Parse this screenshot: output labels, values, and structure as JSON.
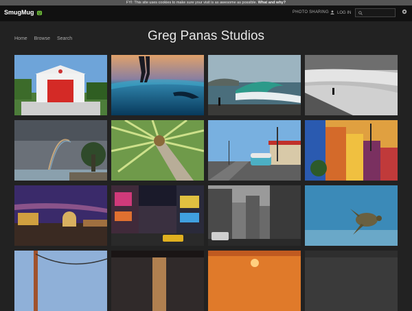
{
  "cookie_banner": {
    "text": "FYI: This site uses cookies to make sure your visit is as awesome as possible.",
    "link": "What and why?"
  },
  "topbar": {
    "brand": "SmugMug",
    "photo_sharing": "PHOTO SHARING",
    "login": "LOG IN"
  },
  "site": {
    "title": "Greg Panas Studios",
    "menu": [
      "Home",
      "Browse",
      "Search"
    ]
  },
  "icons": [
    "smugmug-face-icon",
    "user-icon",
    "search-icon",
    "gear-icon"
  ],
  "colors": {
    "topbar": "#111111",
    "page": "#222222",
    "banner": "#555555",
    "text": "#e6e6e6"
  },
  "gallery": [
    {
      "name": "red-fire-station-photo"
    },
    {
      "name": "surfer-underwater-photo"
    },
    {
      "name": "wave-cliff-photo"
    },
    {
      "name": "surfer-beach-bw-photo"
    },
    {
      "name": "rainbow-ocean-photo"
    },
    {
      "name": "palm-tree-photo"
    },
    {
      "name": "vw-bus-street-photo"
    },
    {
      "name": "colorful-buildings-photo"
    },
    {
      "name": "night-city-dome-photo"
    },
    {
      "name": "times-square-photo"
    },
    {
      "name": "city-street-bw-photo"
    },
    {
      "name": "sea-turtle-photo"
    },
    {
      "name": "bridge-photo"
    },
    {
      "name": "pier-silhouette-photo"
    },
    {
      "name": "sunset-pier-photo"
    },
    {
      "name": "gray-ocean-photo"
    }
  ]
}
